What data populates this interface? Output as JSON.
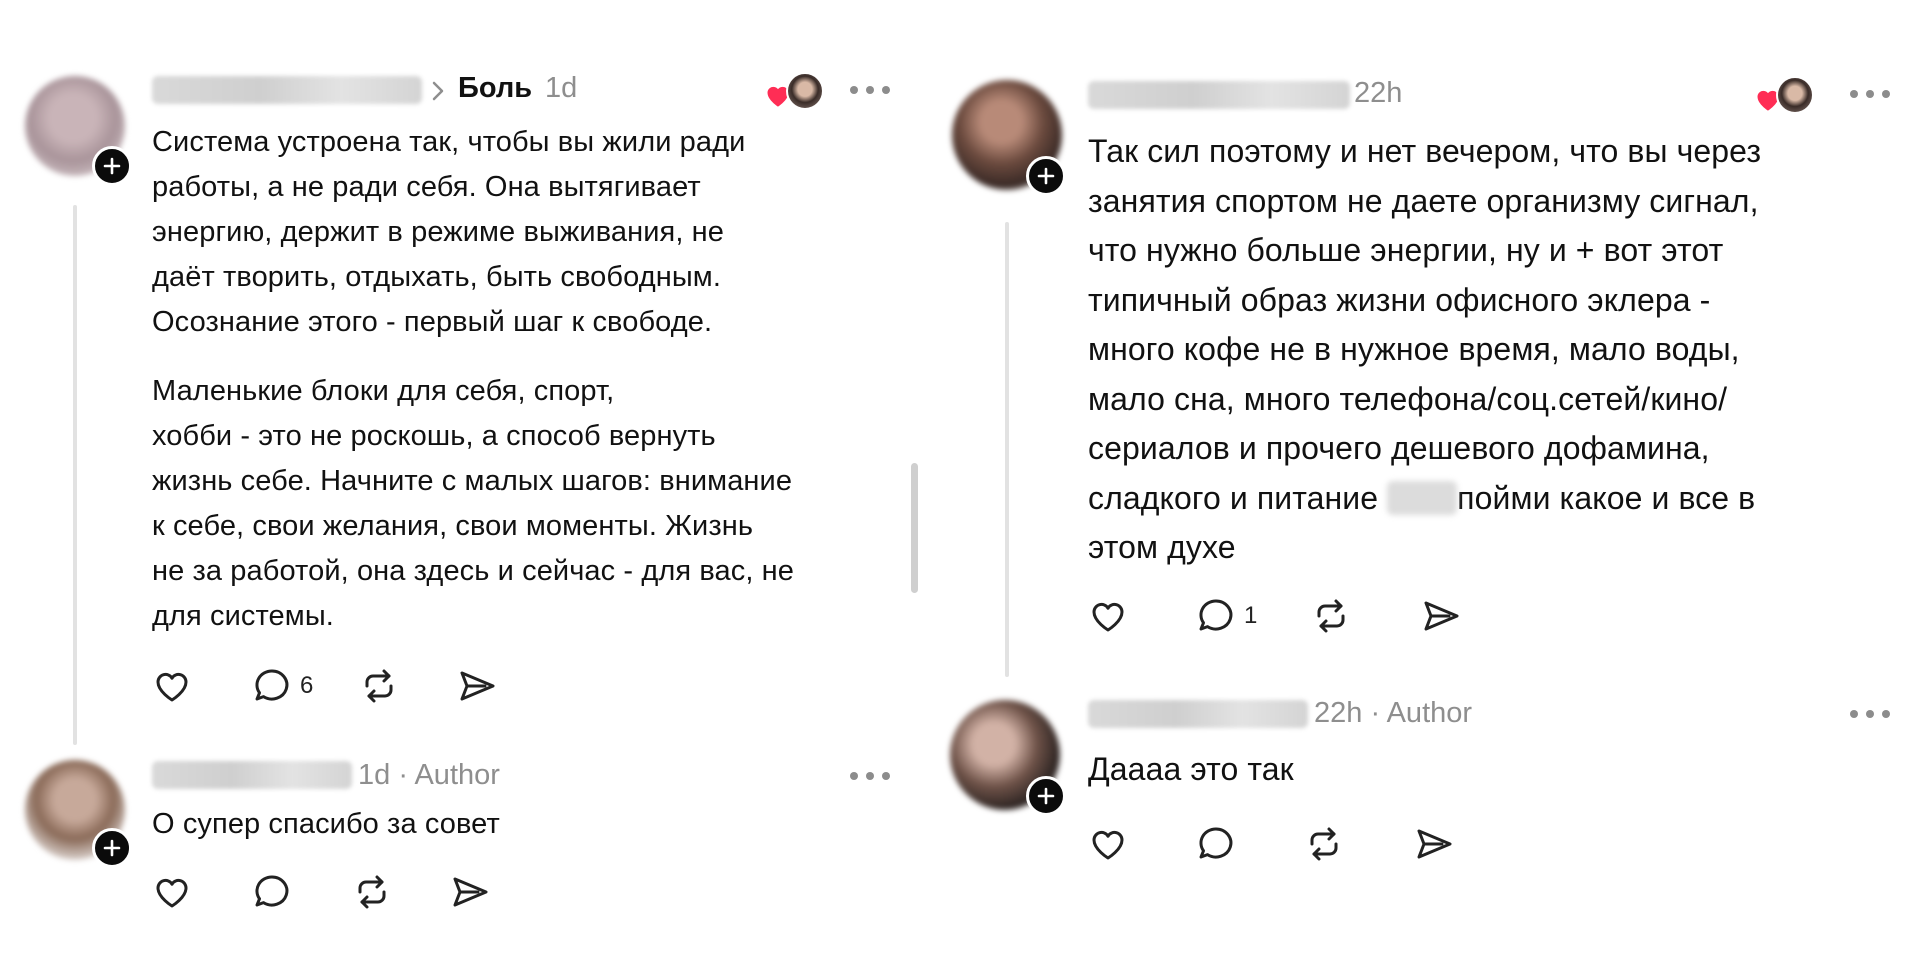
{
  "left": {
    "post": {
      "author_name": "",
      "topic": "Боль",
      "time": "1d",
      "paragraphs": [
        [
          "Система устроена так, чтобы вы жили ради",
          "работы, а не ради себя. Она вытягивает",
          "энергию, держит в режиме выживания, не",
          "даёт творить, отдыхать, быть свободным.",
          "Осознание этого - первый шаг к свободе."
        ],
        [
          "Маленькие блоки для себя, спорт,",
          "хобби - это не роскошь, а способ вернуть",
          "жизнь себе. Начните с малых шагов: внимание",
          "к себе, свои желания, свои моменты. Жизнь",
          "не за работой, она здесь и сейчас - для вас, не",
          "для системы."
        ]
      ],
      "replies_count": "6"
    },
    "reply": {
      "time": "1d",
      "separator": "·",
      "badge": "Author",
      "text": "О супер спасибо за совет"
    }
  },
  "right": {
    "post": {
      "time": "22h",
      "lines": [
        "Так сил поэтому и нет вечером, что вы через",
        "занятия спортом не даете организму сигнал,",
        "что нужно больше энергии, ну и + вот этот",
        "типичный образ жизни офисного эклера -",
        "много кофе не в нужное время, мало воды,",
        "мало сна, много телефона/соц.сетей/кино/",
        "сериалов и прочего дешевого дофамина,"
      ],
      "line_pre_redact": "сладкого и питание",
      "line_post_redact": "пойми какое и все в",
      "last_line": "этом духе",
      "replies_count": "1"
    },
    "reply": {
      "time": "22h",
      "separator": "·",
      "badge": "Author",
      "text": "Даааа это так"
    }
  },
  "icons": {
    "like": "heart-icon",
    "reply": "comment-icon",
    "repost": "repost-icon",
    "share": "send-icon",
    "more": "more-icon",
    "follow": "plus-icon"
  },
  "colors": {
    "heart": "#ff2d55",
    "text": "#111111",
    "muted": "#8e8e8e",
    "thread_line": "#e2e2e2"
  }
}
